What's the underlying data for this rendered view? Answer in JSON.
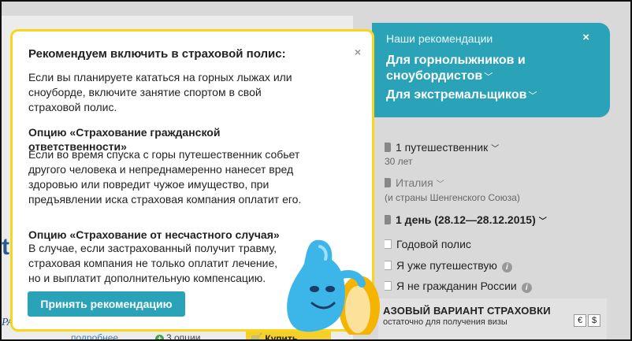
{
  "colors": {
    "teal": "#2aa3b8",
    "popup_border": "#f6d71c",
    "buy_button": "#f5cf2a"
  },
  "recommendations": {
    "title": "Наши рекомендации",
    "close_icon": "×",
    "link1": "Для горнолыжников и сноубордистов",
    "link2": "Для экстремальщиков"
  },
  "form": {
    "travelers": "1 путешественник",
    "age": "30 лет",
    "country": "Италия",
    "country_note": "(и страны Шенгенского Союза)",
    "dates": "1 день (28.12—28.12.2015)",
    "annual": "Годовой полис",
    "already_traveling": "Я уже путешествую",
    "not_citizen": "Я не гражданин России"
  },
  "base": {
    "title": "АЗОВЫЙ ВАРИАНТ СТРАХОВКИ",
    "subtitle": "остаточно для получения визы",
    "eur": "€",
    "usd": "$"
  },
  "background": {
    "more": "подробнее",
    "options": "3 опции",
    "buy": "Купить"
  },
  "popup": {
    "title": "Рекомендуем включить в страховой полис:",
    "intro": "Если вы планируете кататься на горных лыжах или сноуборде, включите занятие спортом в свой страховой полис.",
    "heading1": "Опцию «Страхование гражданской ответственности»",
    "text1": "Если во время спуска с горы путешественник собьет другого человека и непреднамеренно нанесет вред здоровью или повредит чужое имущество, при предъявлении иска страховая компания оплатит его.",
    "heading2": "Опцию «Страхование от несчастного случая»",
    "text2": "В случае, если застрахованный получит травму, страховая компания не только оплатит лечение, но и выплатит дополнительную компенсацию.",
    "accept_button": "Принять рекомендацию",
    "close_icon": "×"
  }
}
